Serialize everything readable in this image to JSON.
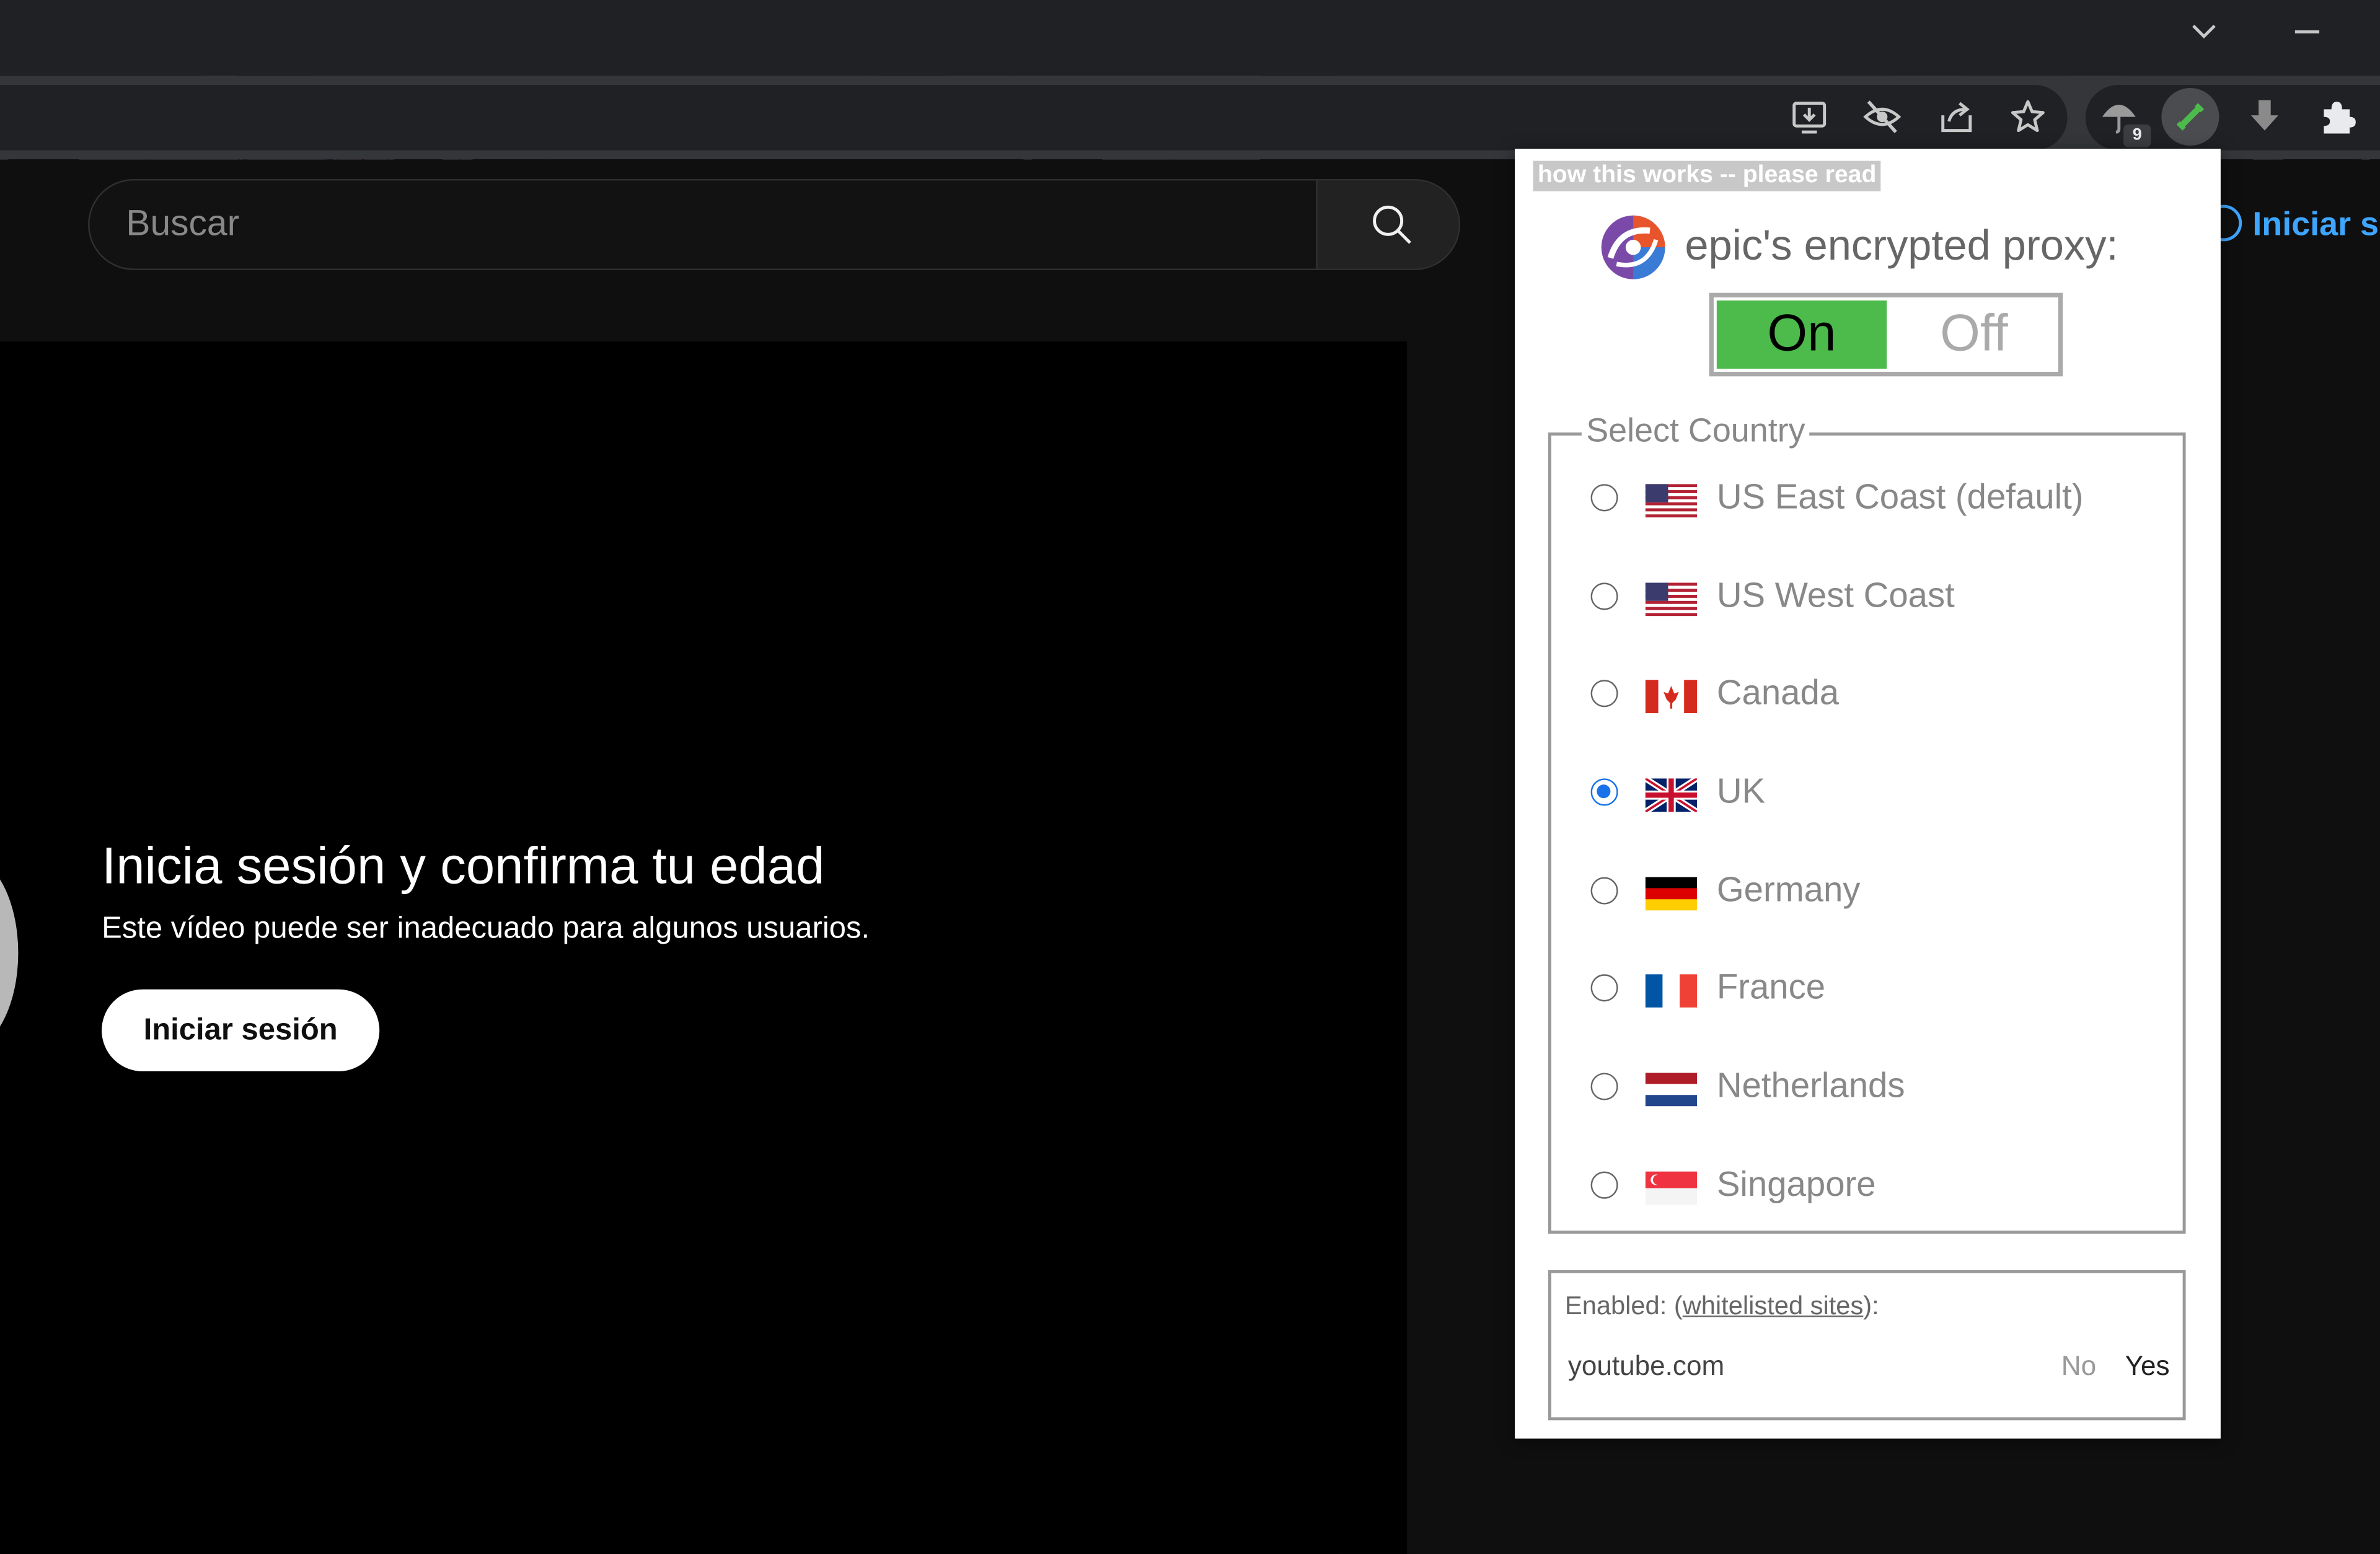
{
  "browser": {
    "toolbar_icons": [
      "install-app-icon",
      "eye-off-icon",
      "share-icon",
      "bookmark-star-icon"
    ],
    "extensions": {
      "umbrella_badge": "9",
      "icons": [
        "umbrella-extension-icon",
        "epic-proxy-extension-icon",
        "download-icon",
        "puzzle-icon"
      ]
    }
  },
  "youtube": {
    "search_placeholder": "Buscar",
    "signin_label": "Iniciar se",
    "age_gate": {
      "title": "Inicia sesión y confirma tu edad",
      "subtitle": "Este vídeo puede ser inadecuado para algunos usuarios.",
      "button": "Iniciar sesión"
    }
  },
  "popup": {
    "help_link": "how this works -- please read",
    "title": "epic's encrypted proxy:",
    "toggle": {
      "on": "On",
      "off": "Off",
      "state": "On"
    },
    "country_legend": "Select Country",
    "countries": [
      {
        "name": "US East Coast (default)",
        "flag": "us-flag-icon",
        "selected": false
      },
      {
        "name": "US West Coast",
        "flag": "us-flag-icon",
        "selected": false
      },
      {
        "name": "Canada",
        "flag": "canada-flag-icon",
        "selected": false
      },
      {
        "name": "UK",
        "flag": "uk-flag-icon",
        "selected": true
      },
      {
        "name": "Germany",
        "flag": "germany-flag-icon",
        "selected": false
      },
      {
        "name": "France",
        "flag": "france-flag-icon",
        "selected": false
      },
      {
        "name": "Netherlands",
        "flag": "netherlands-flag-icon",
        "selected": false
      },
      {
        "name": "Singapore",
        "flag": "singapore-flag-icon",
        "selected": false
      }
    ],
    "enabled": {
      "prefix": "Enabled: (",
      "link": "whitelisted sites",
      "suffix": "):",
      "site": "youtube.com",
      "no": "No",
      "yes": "Yes"
    }
  }
}
